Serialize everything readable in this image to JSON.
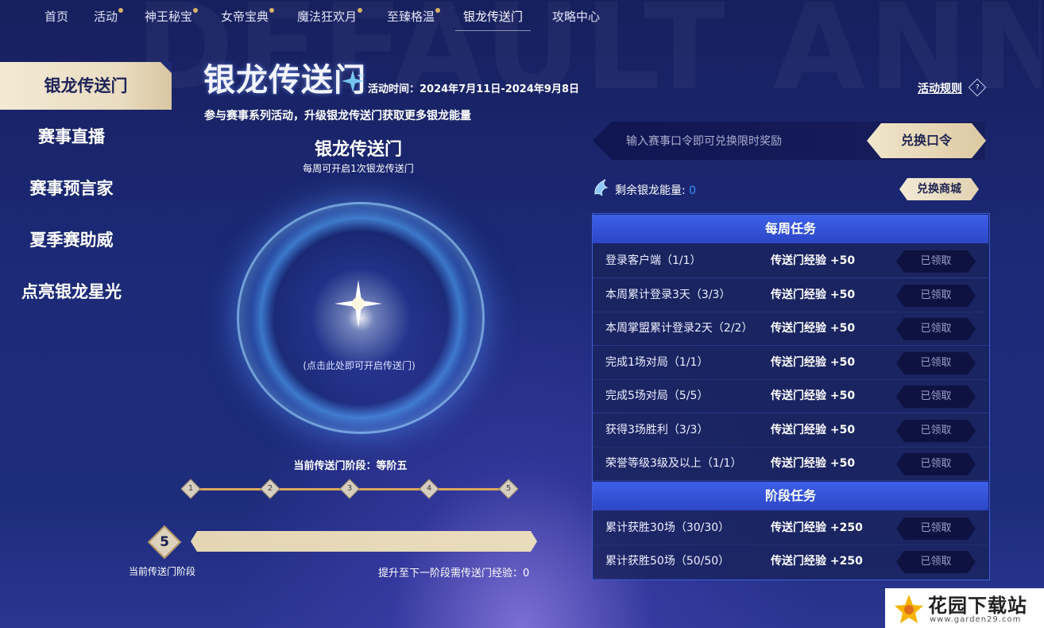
{
  "background_text": "DEFAULT ANNIVERSARY",
  "nav": {
    "items": [
      {
        "label": "首页",
        "dot": false
      },
      {
        "label": "活动",
        "dot": true
      },
      {
        "label": "神王秘宝",
        "dot": true
      },
      {
        "label": "女帝宝典",
        "dot": true
      },
      {
        "label": "魔法狂欢月",
        "dot": true
      },
      {
        "label": "至臻格温",
        "dot": true
      },
      {
        "label": "银龙传送门",
        "dot": false,
        "active": true
      },
      {
        "label": "攻略中心",
        "dot": false
      }
    ]
  },
  "sidebar": {
    "items": [
      {
        "label": "银龙传送门",
        "active": true
      },
      {
        "label": "赛事直播"
      },
      {
        "label": "赛事预言家"
      },
      {
        "label": "夏季赛助威"
      },
      {
        "label": "点亮银龙星光"
      }
    ]
  },
  "header": {
    "title": "银龙传送门",
    "activity_time": "活动时间：2024年7月11日-2024年9月8日",
    "subtitle": "参与赛事系列活动，升级银龙传送门获取更多银龙能量",
    "rules_label": "活动规则",
    "rules_icon": "?"
  },
  "portal": {
    "title": "银龙传送门",
    "subtitle": "每周可开启1次银龙传送门",
    "hint": "(点击此处即可开启传送门)"
  },
  "stage": {
    "current_label": "当前传送门阶段：等阶五",
    "nodes": [
      "1",
      "2",
      "3",
      "4",
      "5"
    ],
    "level": "5",
    "level_label": "当前传送门阶段",
    "next_exp_label": "提升至下一阶段需传送门经验：0",
    "progress": 1.0
  },
  "code": {
    "placeholder": "输入赛事口令即可兑换限时奖励",
    "button": "兑换口令"
  },
  "energy": {
    "label": "剩余银龙能量:",
    "value": "0",
    "shop_button": "兑换商城"
  },
  "weekly": {
    "title": "每周任务",
    "tasks": [
      {
        "name": "登录客户端（1/1）",
        "reward": "传送门经验 +50",
        "status": "已领取"
      },
      {
        "name": "本周累计登录3天（3/3）",
        "reward": "传送门经验 +50",
        "status": "已领取"
      },
      {
        "name": "本周掌盟累计登录2天（2/2）",
        "reward": "传送门经验 +50",
        "status": "已领取"
      },
      {
        "name": "完成1场对局（1/1）",
        "reward": "传送门经验 +50",
        "status": "已领取"
      },
      {
        "name": "完成5场对局（5/5）",
        "reward": "传送门经验 +50",
        "status": "已领取"
      },
      {
        "name": "获得3场胜利（3/3）",
        "reward": "传送门经验 +50",
        "status": "已领取"
      },
      {
        "name": "荣誉等级3级及以上（1/1）",
        "reward": "传送门经验 +50",
        "status": "已领取"
      }
    ]
  },
  "stage_tasks": {
    "title": "阶段任务",
    "tasks": [
      {
        "name": "累计获胜30场（30/30）",
        "reward": "传送门经验 +250",
        "status": "已领取"
      },
      {
        "name": "累计获胜50场（50/50）",
        "reward": "传送门经验 +250",
        "status": "已领取"
      }
    ]
  },
  "watermark": {
    "text": "花园下载站",
    "url": "www.garden29.com"
  }
}
